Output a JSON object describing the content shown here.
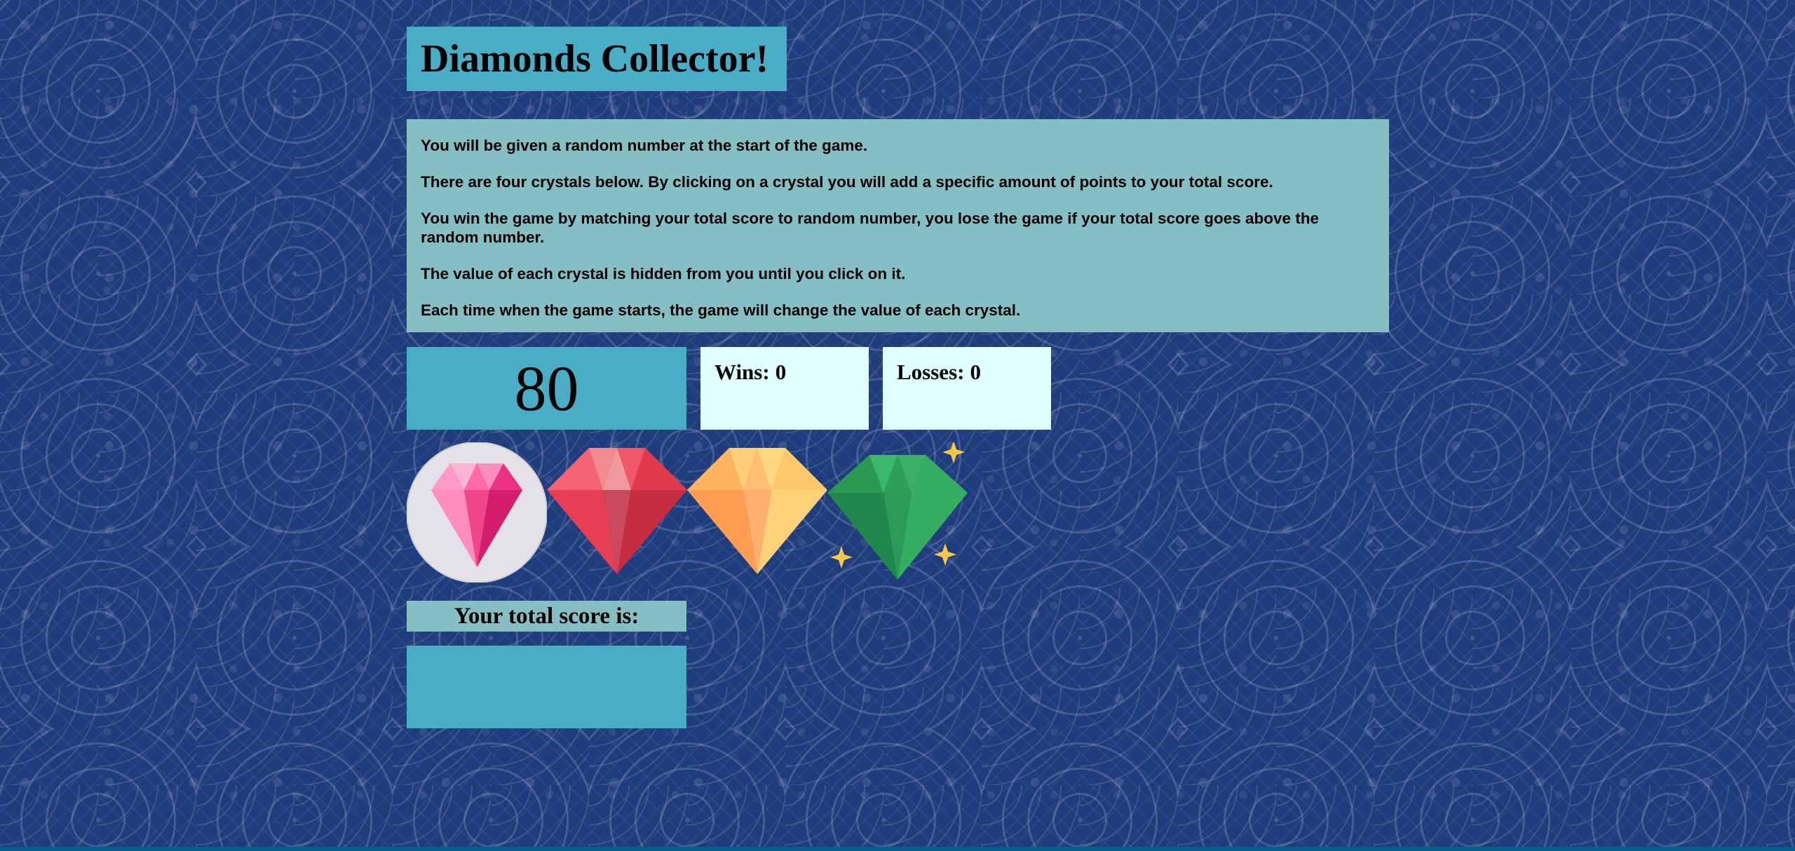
{
  "game": {
    "title": "Diamonds Collector!",
    "instructions": [
      "You will be given a random number at the start of the game.",
      "There are four crystals below. By clicking on a crystal you will add a specific amount of points to your total score.",
      "You win the game by matching your total score to random number, you lose the game if your total score goes above the random number.",
      "The value of each crystal is hidden from you until you click on it.",
      "Each time when the game starts, the game will change the value of each crystal."
    ],
    "target_number": "80",
    "wins_label": "Wins:",
    "wins": "0",
    "losses_label": "Losses:",
    "losses": "0",
    "score_label": "Your total score is:",
    "total_score": ""
  },
  "crystals": [
    {
      "icon": "pink-diamond-icon",
      "color": "#f0468a"
    },
    {
      "icon": "red-diamond-icon",
      "color": "#d4394f"
    },
    {
      "icon": "orange-diamond-icon",
      "color": "#ffa25a"
    },
    {
      "icon": "green-diamond-icon",
      "color": "#23954f"
    }
  ],
  "colors": {
    "title_bg": "#49adc6",
    "instructions_bg": "#85bfc3",
    "stat_bg": "#e0ffff",
    "background": "#1f3c7c"
  }
}
